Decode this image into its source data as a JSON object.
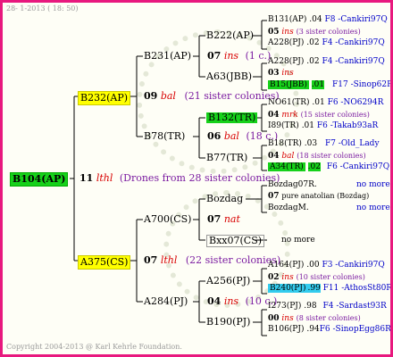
{
  "header": {
    "date": "28- 1-2013 ( 18: 50)"
  },
  "footer": {
    "copyright": "Copyright 2004-2013 @ Karl Kehrle Foundation."
  },
  "colors": {
    "border": "#e8187e",
    "queen_bg": "#ffff00",
    "selected_bg": "#16d11a",
    "cyan_bg": "#33ccee",
    "link": "#0000c8",
    "sister": "#7a1aa0",
    "line_code": "#d80000"
  },
  "root": {
    "id": "B104(AP)",
    "gen": "11",
    "line": "lthl",
    "note": "(Drones from 28 sister colonies)"
  },
  "sire": {
    "id": "B232(AP)",
    "gen": "09",
    "line": "bal",
    "note": "(21 sister colonies)"
  },
  "dam": {
    "id": "A375(CS)",
    "gen": "07",
    "line": "lthl",
    "note": "(22 sister colonies)"
  },
  "sire_sire": {
    "id": "B231(AP)",
    "gen": "07",
    "line": "ins",
    "note": "(1 c.)"
  },
  "sire_dam": {
    "id": "B78(TR)",
    "gen": "06",
    "line": "bal",
    "note": "(18 c.)"
  },
  "dam_sire": {
    "id": "A700(CS)",
    "gen": "07",
    "line": "nat"
  },
  "dam_dam": {
    "id": "A284(PJ)",
    "gen": "04",
    "line": "ins",
    "note": "(10 c.)"
  },
  "g3": {
    "b222": "B222(AP)",
    "a63": "A63(JBB)",
    "b132": "B132(TR)",
    "b77": "B77(TR)",
    "bozdag": "Bozdag",
    "bxx07": "Bxx07(CS)",
    "a256": "A256(PJ)",
    "b190": "B190(PJ)"
  },
  "g4": {
    "r1": {
      "id": "B131(AP)",
      "num": ".04",
      "place": "F8 -Cankiri97Q"
    },
    "r2": {
      "gen": "05",
      "line": "ins",
      "note": "(3 sister colonies)"
    },
    "r3": {
      "id": "A228(PJ)",
      "num": ".02",
      "place": "F4 -Cankiri97Q"
    },
    "r4": {
      "id": "A228(PJ)",
      "num": ".02",
      "place": "F4 -Cankiri97Q"
    },
    "r5": {
      "gen": "03",
      "line": "ins"
    },
    "r6": {
      "id": "B15(JBB)",
      "num": ".01",
      "place": "F17 -Sinop62R"
    },
    "r7": {
      "id": "NO61(TR)",
      "num": ".01",
      "place": "F6 -NO6294R"
    },
    "r8": {
      "gen": "04",
      "line": "mrk",
      "note": "(15 sister colonies)"
    },
    "r9": {
      "id": "I89(TR)",
      "num": ".01",
      "place": "F6 -Takab93aR"
    },
    "r10": {
      "id": "B18(TR)",
      "num": ".03",
      "place": "F7 -Old_Lady"
    },
    "r11": {
      "gen": "04",
      "line": "bal",
      "note": "(18 sister colonies)"
    },
    "r12": {
      "id": "A34(TR)",
      "num": ".02",
      "place": "F6 -Cankiri97Q"
    },
    "r13": {
      "id": "Bozdag07R",
      "num": ".",
      "place": "no more"
    },
    "r14": {
      "gen": "07",
      "note": "pure anatolian (Bozdag)"
    },
    "r15": {
      "id": "BozdagM",
      "num": ".",
      "place": "no more"
    },
    "r16": {
      "place": "no more"
    },
    "r17": {
      "id": "A164(PJ)",
      "num": ".00",
      "place": "F3 -Cankiri97Q"
    },
    "r18": {
      "gen": "02",
      "line": "ins",
      "note": "(10 sister colonies)"
    },
    "r19": {
      "id": "B240(PJ)",
      "num": ".99",
      "place": "F11 -AthosSt80R"
    },
    "r20": {
      "id": "I273(PJ)",
      "num": ".98",
      "place": "F4 -Sardast93R"
    },
    "r21": {
      "gen": "00",
      "line": "ins",
      "note": "(8 sister colonies)"
    },
    "r22": {
      "id": "B106(PJ)",
      "num": ".94",
      "place": "F6 -SinopEgg86R"
    }
  }
}
